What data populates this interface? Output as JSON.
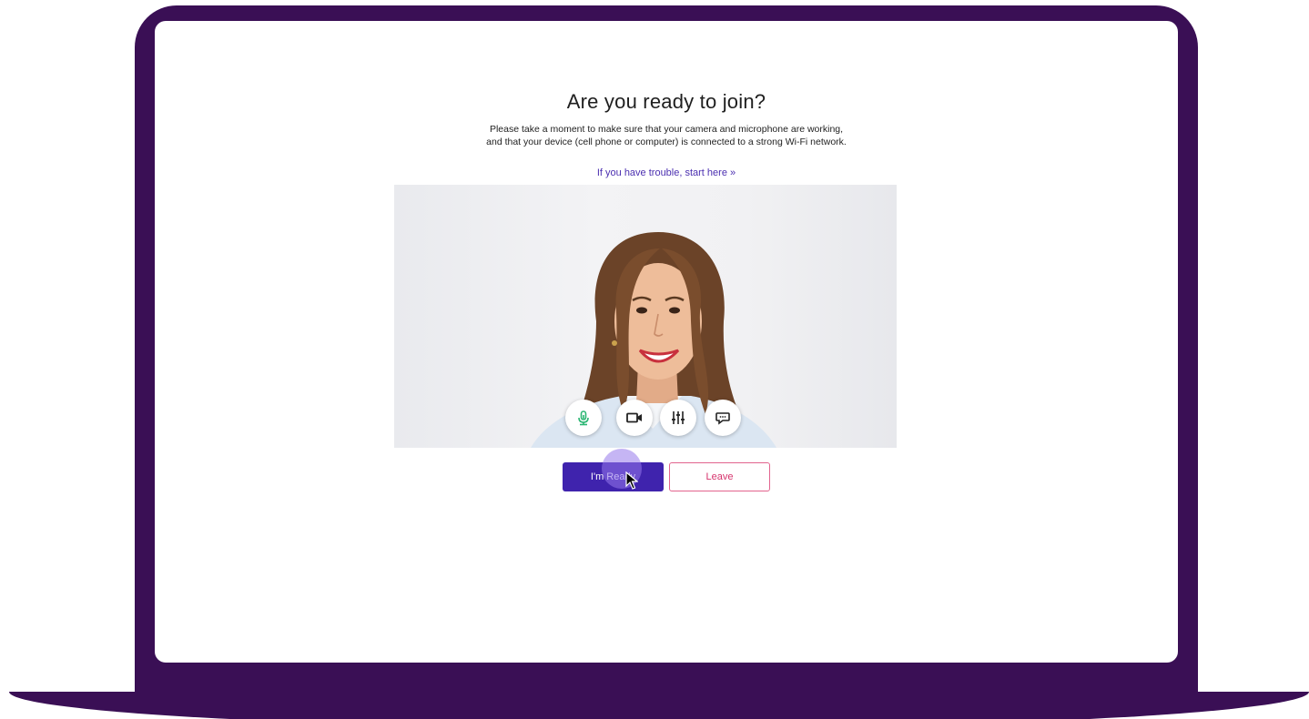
{
  "colors": {
    "laptop_frame": "#3a0f55",
    "primary_button": "#3f23ad",
    "leave_button_text": "#d6336c",
    "link": "#4b2fb0",
    "mic_icon_active": "#2bb673"
  },
  "page": {
    "title": "Are you ready to join?",
    "instructions_line1": "Please take a moment to make sure that your camera and microphone are working,",
    "instructions_line2": "and that your device (cell phone or computer) is connected to a strong Wi-Fi network.",
    "trouble_link": "If you have trouble, start here »"
  },
  "video": {
    "controls": [
      {
        "icon": "microphone-icon",
        "state": "active"
      },
      {
        "icon": "video-camera-icon"
      },
      {
        "icon": "settings-sliders-icon"
      },
      {
        "icon": "chat-bubble-icon"
      }
    ]
  },
  "actions": {
    "ready_label": "I'm Ready",
    "leave_label": "Leave"
  }
}
